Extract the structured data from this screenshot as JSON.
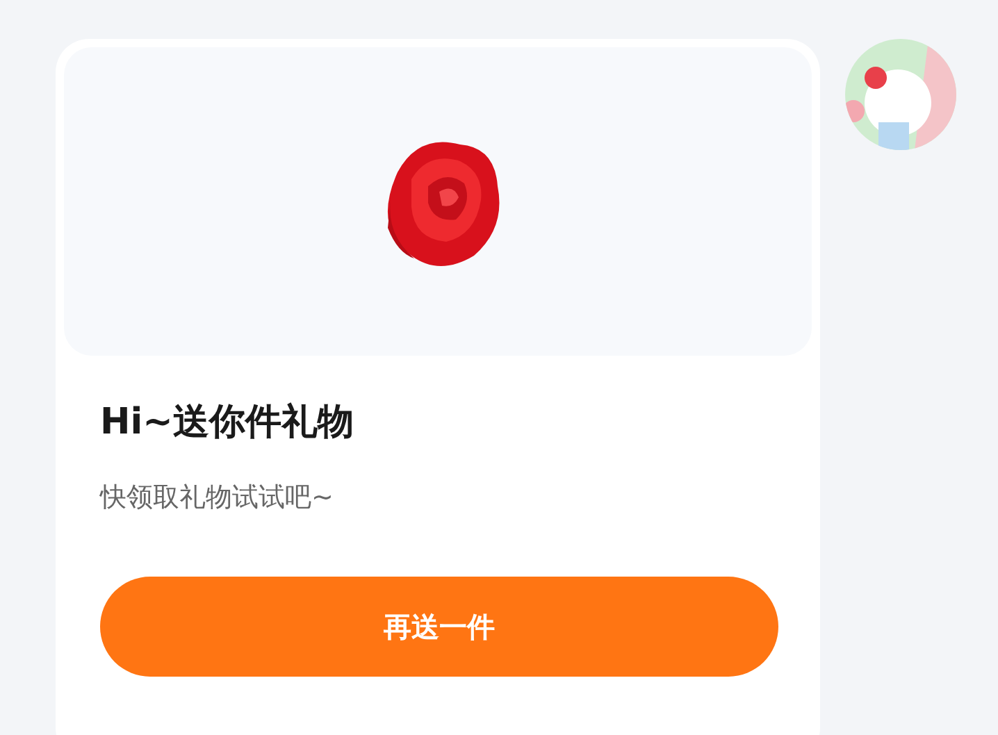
{
  "gift_card": {
    "title": "Hi~送你件礼物",
    "subtitle": "快领取礼物试试吧~",
    "button": "再送一件"
  }
}
